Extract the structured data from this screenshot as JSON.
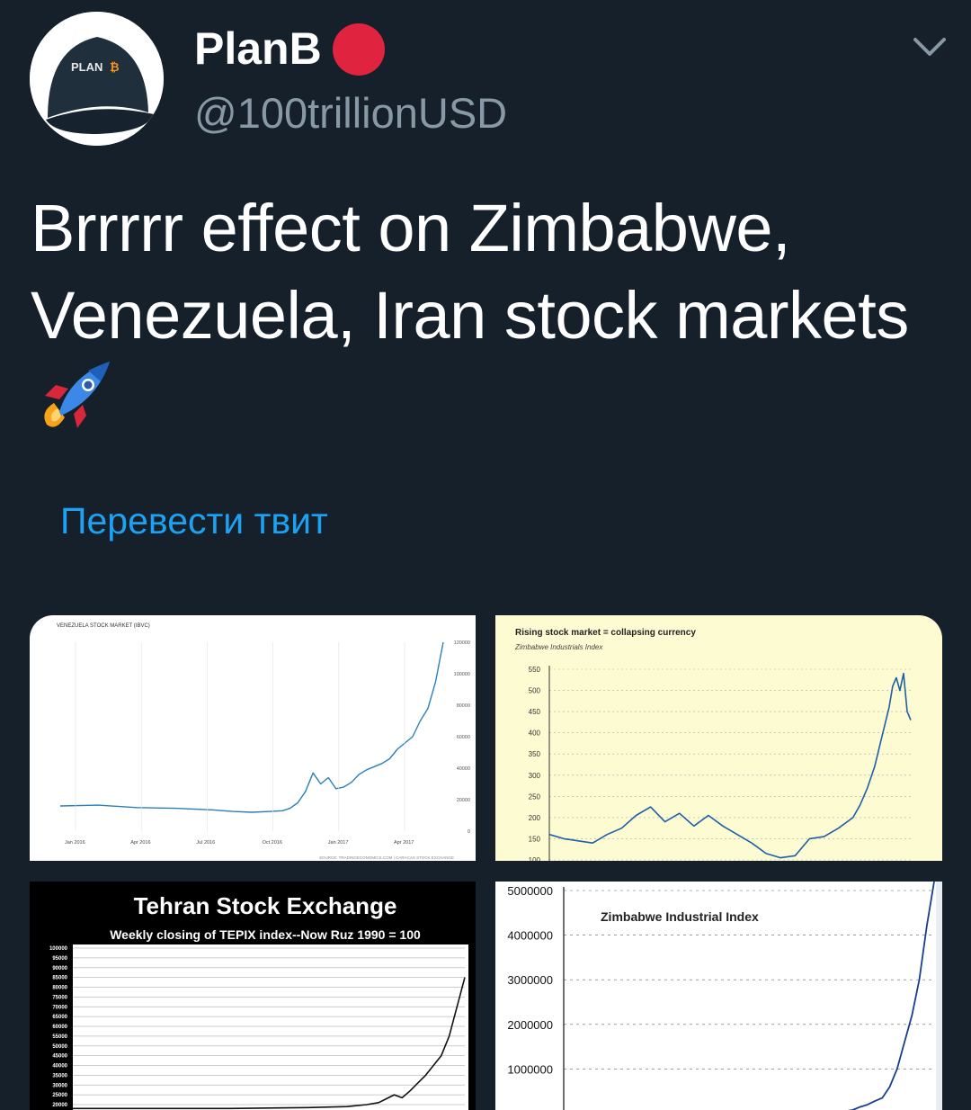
{
  "tweet": {
    "author_name": "PlanB",
    "handle": "@100trillionUSD",
    "avatar_text": "PLAN",
    "text_line1": "Brrrrr effect on Zimbabwe,",
    "text_line2": "Venezuela, Iran stock markets",
    "emoji": "rocket-emoji",
    "translate_label": "Перевести твит"
  },
  "colors": {
    "background": "#15202b",
    "handle": "#8899a6",
    "link": "#1da1f2",
    "record_dot": "#e0243f"
  },
  "media": [
    {
      "title": "VENEZUELA STOCK MARKET (IBVC)",
      "source": "SOURCE: TRADINGECONOMICS.COM | CARACAS STOCK EXCHANGE",
      "chart_data": {
        "type": "line",
        "x_ticks": [
          "Jan 2016",
          "Apr 2016",
          "Jul 2016",
          "Oct 2016",
          "Jan 2017",
          "Apr 2017"
        ],
        "y_ticks": [
          0,
          20000,
          40000,
          60000,
          80000,
          100000,
          120000
        ],
        "ylim": [
          0,
          120000
        ],
        "x": [
          0,
          10,
          20,
          30,
          40,
          45,
          50,
          55,
          58,
          60,
          62,
          64,
          66,
          68,
          70,
          72,
          74,
          76,
          78,
          80,
          82,
          84,
          86,
          88,
          90,
          92,
          94,
          96,
          98,
          100
        ],
        "values": [
          16000,
          16500,
          15000,
          14500,
          13500,
          12500,
          12000,
          12500,
          13000,
          14500,
          18000,
          25000,
          37000,
          30000,
          34000,
          27000,
          28000,
          31000,
          36000,
          39000,
          41000,
          43000,
          46000,
          52000,
          56000,
          60000,
          70000,
          78000,
          95000,
          120000
        ]
      }
    },
    {
      "title": "Rising stock market = collapsing currency",
      "subtitle": "Zimbabwe Industrials Index",
      "chart_data": {
        "type": "line",
        "y_ticks": [
          100,
          150,
          200,
          250,
          300,
          350,
          400,
          450,
          500,
          550
        ],
        "ylim": [
          100,
          550
        ],
        "x": [
          0,
          4,
          8,
          12,
          16,
          20,
          24,
          28,
          32,
          36,
          40,
          44,
          48,
          52,
          56,
          60,
          64,
          68,
          72,
          76,
          80,
          84,
          86,
          88,
          90,
          92,
          94,
          95,
          96,
          97,
          98,
          99,
          100
        ],
        "values": [
          160,
          150,
          145,
          140,
          160,
          175,
          205,
          225,
          190,
          210,
          180,
          205,
          180,
          160,
          140,
          115,
          105,
          110,
          150,
          155,
          175,
          200,
          230,
          270,
          320,
          390,
          460,
          510,
          530,
          500,
          540,
          450,
          430
        ]
      }
    },
    {
      "title": "Tehran Stock Exchange",
      "subtitle": "Weekly closing of TEPIX index--Now Ruz 1990 = 100",
      "chart_data": {
        "type": "line",
        "y_ticks": [
          20000,
          25000,
          30000,
          35000,
          40000,
          45000,
          50000,
          55000,
          60000,
          65000,
          70000,
          75000,
          80000,
          85000,
          90000,
          95000,
          100000
        ],
        "ylim": [
          20000,
          100000
        ],
        "x": [
          0,
          20,
          40,
          60,
          70,
          75,
          78,
          80,
          82,
          84,
          86,
          88,
          90,
          92,
          94,
          96,
          98,
          100
        ],
        "values": [
          18000,
          18000,
          18000,
          18500,
          19000,
          20000,
          21000,
          23000,
          25000,
          23500,
          27000,
          31000,
          35000,
          40000,
          45000,
          55000,
          70000,
          85000
        ]
      }
    },
    {
      "title": "Zimbabwe Industrial Index",
      "chart_data": {
        "type": "line",
        "y_ticks": [
          1000000,
          2000000,
          3000000,
          4000000,
          5000000
        ],
        "ylim": [
          0,
          5000000
        ],
        "x": [
          0,
          20,
          40,
          60,
          70,
          75,
          78,
          80,
          82,
          84,
          86,
          88,
          90,
          92,
          94,
          96,
          98,
          100
        ],
        "values": [
          0,
          0,
          0,
          0,
          5000,
          40000,
          80000,
          150000,
          200000,
          280000,
          350000,
          600000,
          1000000,
          1600000,
          2200000,
          3000000,
          4200000,
          5200000
        ]
      }
    }
  ]
}
